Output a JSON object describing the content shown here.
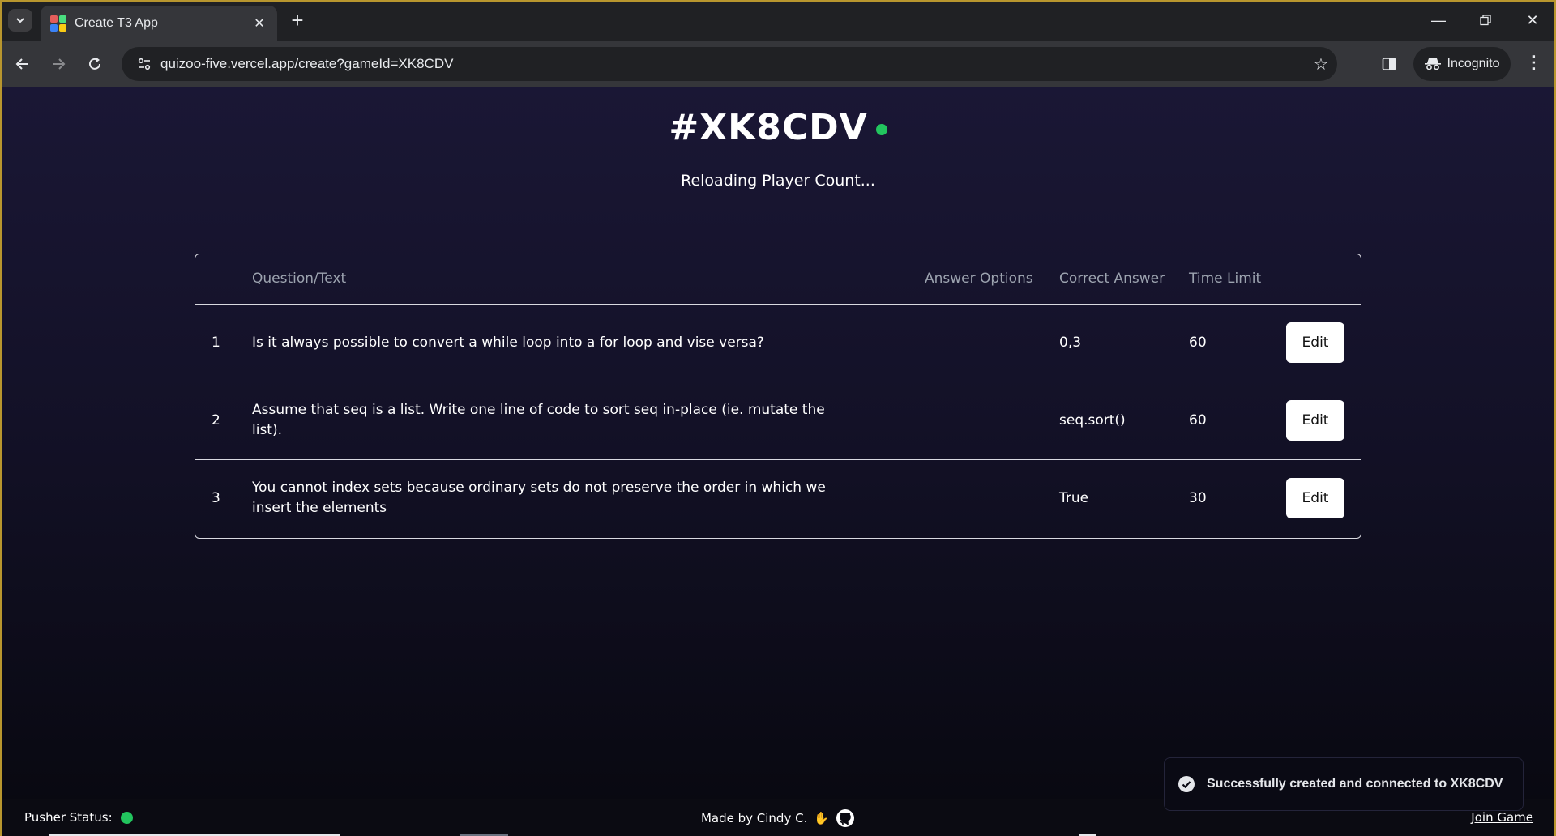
{
  "browser": {
    "tab_title": "Create T3 App",
    "url": "quizoo-five.vercel.app/create?gameId=XK8CDV",
    "profile_label": "Incognito",
    "favicon_colors": [
      "#e35d5b",
      "#4ade80",
      "#3b82f6",
      "#facc15"
    ]
  },
  "game": {
    "code": "#XK8CDV",
    "player_count_text": "Reloading Player Count...",
    "connected": true
  },
  "table": {
    "headers": {
      "number": "",
      "question": "Question/Text",
      "options": "Answer Options",
      "answer": "Correct Answer",
      "time": "Time Limit",
      "action": ""
    },
    "rows": [
      {
        "number": "1",
        "question": "Is it always possible to convert a while loop into a for loop and vise versa?",
        "options": "",
        "answer": "0,3",
        "time": "60",
        "action": "Edit"
      },
      {
        "number": "2",
        "question": "Assume that seq is a list. Write one line of code to sort seq in-place (ie. mutate the list).",
        "options": "",
        "answer": "seq.sort()",
        "time": "60",
        "action": "Edit"
      },
      {
        "number": "3",
        "question": "You cannot index sets because ordinary sets do not preserve the order in which we insert the elements",
        "options": "",
        "answer": "True",
        "time": "30",
        "action": "Edit"
      }
    ]
  },
  "toast": {
    "message": "Successfully created and connected to XK8CDV"
  },
  "footer": {
    "pusher_label": "Pusher Status:",
    "made_by": "Made by Cindy C.",
    "join_game": "Join Game"
  },
  "colors": {
    "status_green": "#22c55e",
    "page_bg_top": "#1a1735",
    "page_bg_bottom": "#08080f"
  }
}
